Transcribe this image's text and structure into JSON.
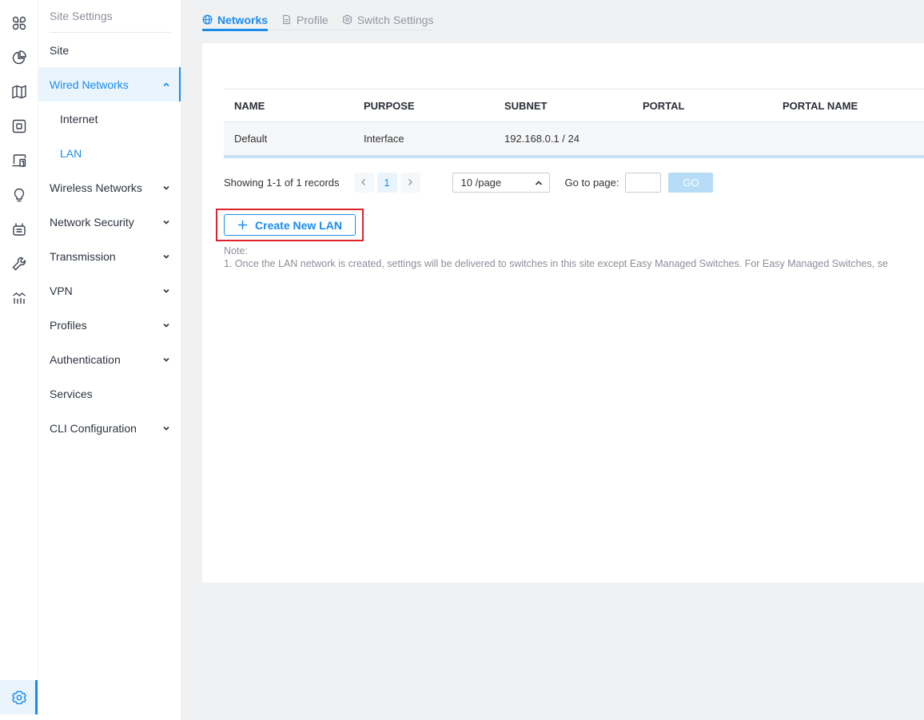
{
  "rail": {
    "items": [
      {
        "icon": "dashboard-icon"
      },
      {
        "icon": "statistics-icon"
      },
      {
        "icon": "map-icon"
      },
      {
        "icon": "devices-icon"
      },
      {
        "icon": "clients-icon"
      },
      {
        "icon": "insight-icon"
      },
      {
        "icon": "logs-icon"
      },
      {
        "icon": "tools-icon"
      },
      {
        "icon": "reports-icon"
      }
    ],
    "settings_icon": "settings-icon"
  },
  "sidebar": {
    "title": "Site Settings",
    "items": [
      {
        "label": "Site"
      },
      {
        "label": "Wired Networks",
        "expanded": true
      },
      {
        "label": "Internet"
      },
      {
        "label": "LAN",
        "selected": true
      },
      {
        "label": "Wireless Networks"
      },
      {
        "label": "Network Security"
      },
      {
        "label": "Transmission"
      },
      {
        "label": "VPN"
      },
      {
        "label": "Profiles"
      },
      {
        "label": "Authentication"
      },
      {
        "label": "Services"
      },
      {
        "label": "CLI Configuration"
      }
    ]
  },
  "tabs": [
    {
      "label": "Networks",
      "icon": "globe-icon",
      "active": true
    },
    {
      "label": "Profile",
      "icon": "document-icon"
    },
    {
      "label": "Switch Settings",
      "icon": "gear-icon"
    }
  ],
  "table": {
    "columns": [
      "NAME",
      "PURPOSE",
      "SUBNET",
      "PORTAL",
      "PORTAL NAME"
    ],
    "rows": [
      {
        "name": "Default",
        "purpose": "Interface",
        "subnet": "192.168.0.1 / 24",
        "portal": "",
        "portal_name": ""
      }
    ]
  },
  "pagination": {
    "info": "Showing 1-1 of 1 records",
    "current_page": "1",
    "page_size": "10 /page",
    "goto_label": "Go to page:",
    "goto_value": "",
    "go_label": "GO"
  },
  "actions": {
    "create_label": "Create New LAN"
  },
  "note": {
    "title": "Note:",
    "line1": "1. Once the LAN network is created, settings will be delivered to switches in this site except Easy Managed Switches. For Easy Managed Switches, se"
  },
  "colors": {
    "accent": "#1a8cec",
    "highlight_box": "#e0232a",
    "go_disabled": "#b6dcf7"
  }
}
